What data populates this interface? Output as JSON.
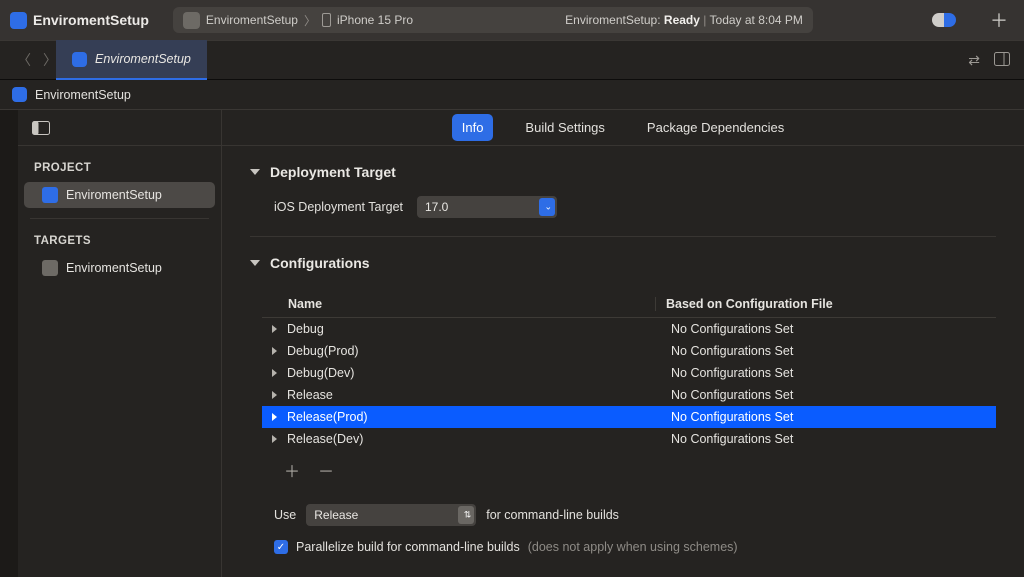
{
  "titlebar": {
    "project_name": "EnviromentSetup",
    "scheme": "EnviromentSetup",
    "device": "iPhone 15 Pro",
    "status_prefix": "EnviromentSetup:",
    "status_word": "Ready",
    "status_time": "Today at 8:04 PM"
  },
  "tab": {
    "title": "EnviromentSetup"
  },
  "crumb": {
    "project": "EnviromentSetup"
  },
  "segments": {
    "info": "Info",
    "build_settings": "Build Settings",
    "package_deps": "Package Dependencies"
  },
  "sidebar": {
    "project_label": "PROJECT",
    "project_name": "EnviromentSetup",
    "targets_label": "TARGETS",
    "target_name": "EnviromentSetup"
  },
  "deployment": {
    "header": "Deployment Target",
    "label": "iOS Deployment Target",
    "value": "17.0"
  },
  "configs": {
    "header": "Configurations",
    "col_name": "Name",
    "col_file": "Based on Configuration File",
    "rows": [
      {
        "name": "Debug",
        "file": "No Configurations Set"
      },
      {
        "name": "Debug(Prod)",
        "file": "No Configurations Set"
      },
      {
        "name": "Debug(Dev)",
        "file": "No Configurations Set"
      },
      {
        "name": "Release",
        "file": "No Configurations Set"
      },
      {
        "name": "Release(Prod)",
        "file": "No Configurations Set"
      },
      {
        "name": "Release(Dev)",
        "file": "No Configurations Set"
      }
    ],
    "selected_index": 4,
    "use_label_pre": "Use",
    "use_value": "Release",
    "use_label_post": "for command-line builds",
    "parallel_label": "Parallelize build for command-line builds",
    "parallel_note": "(does not apply when using schemes)"
  }
}
